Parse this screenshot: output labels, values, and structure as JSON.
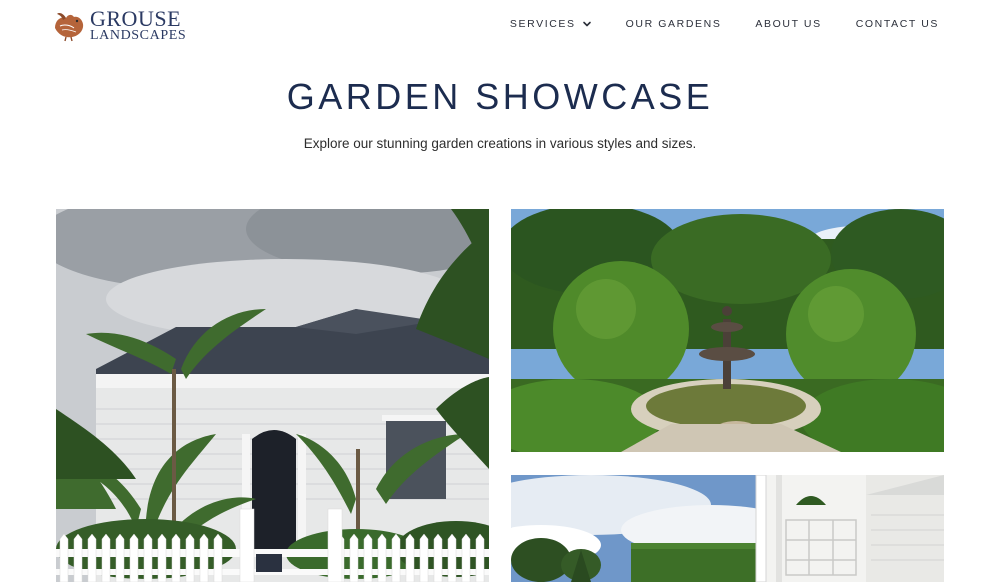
{
  "brand": {
    "name_line1": "GROUSE",
    "name_line2": "LANDSCAPES",
    "colors": {
      "navy": "#1c2c4f",
      "bird": "#b5643a"
    }
  },
  "nav": {
    "items": [
      {
        "label": "SERVICES",
        "has_dropdown": true
      },
      {
        "label": "OUR GARDENS"
      },
      {
        "label": "ABOUT US"
      },
      {
        "label": "CONTACT US"
      }
    ]
  },
  "hero": {
    "title": "GARDEN SHOWCASE",
    "subtitle": "Explore our stunning garden creations in various styles and sizes."
  },
  "gallery": {
    "images": [
      {
        "icon": "villa-garden-photo"
      },
      {
        "icon": "fountain-garden-photo"
      },
      {
        "icon": "hedge-verandah-photo"
      }
    ]
  }
}
